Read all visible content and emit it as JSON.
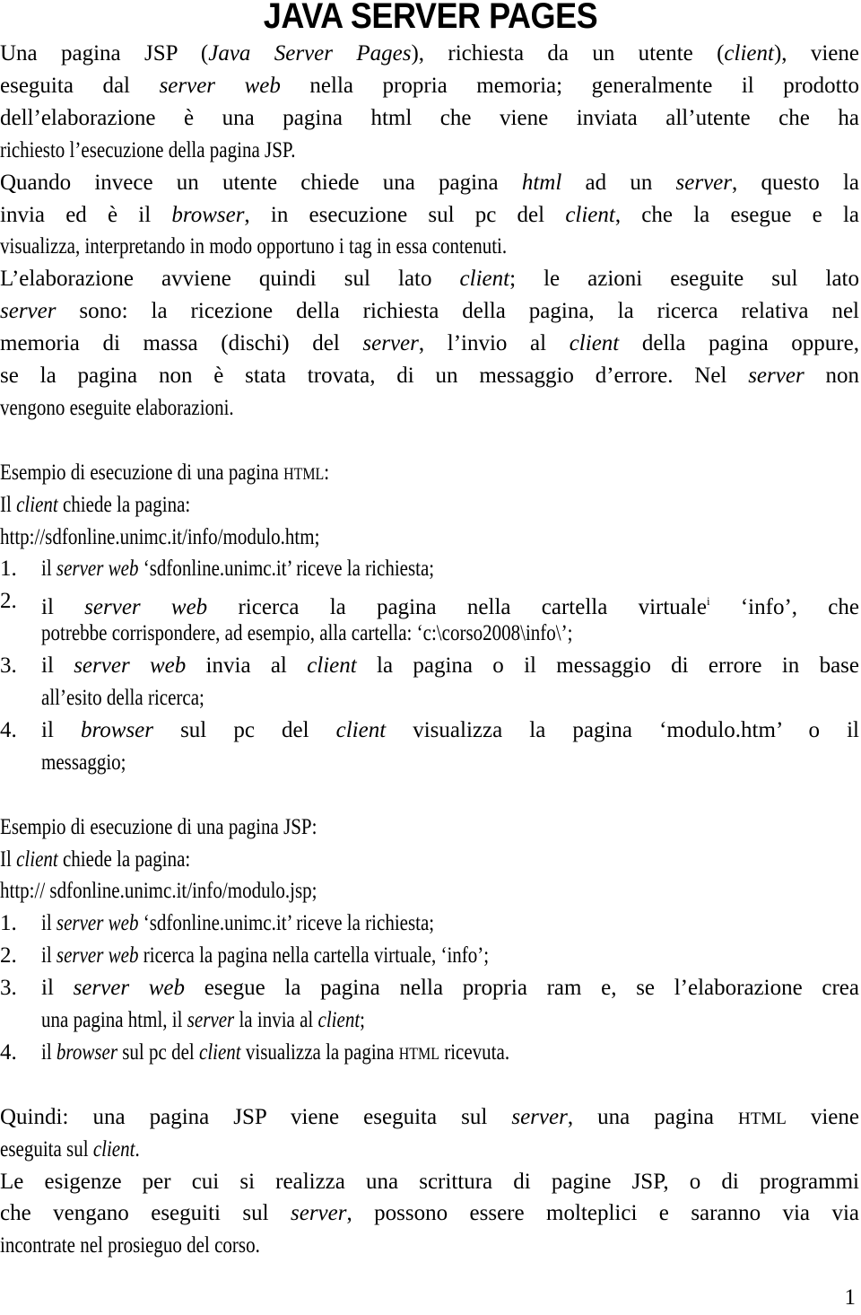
{
  "title": "JAVA SERVER PAGES",
  "page_number": "1",
  "lines": [
    {
      "just": true,
      "segs": [
        [
          "Una pagina JSP (",
          ""
        ],
        [
          "Java Server Pages",
          "i"
        ],
        [
          "), richiesta da un utente (",
          ""
        ],
        [
          "client",
          "i"
        ],
        [
          "),  viene",
          ""
        ]
      ]
    },
    {
      "just": true,
      "segs": [
        [
          "eseguita dal ",
          ""
        ],
        [
          "server web",
          "i"
        ],
        [
          " nella propria memoria; generalmente il prodotto",
          ""
        ]
      ]
    },
    {
      "just": true,
      "segs": [
        [
          "dell’elaborazione è una pagina html che viene inviata all’utente che ha",
          ""
        ]
      ]
    },
    {
      "just": false,
      "segs": [
        [
          "richiesto l’esecuzione della pagina JSP.",
          ""
        ]
      ]
    },
    {
      "just": true,
      "segs": [
        [
          "Quando invece un utente chiede una pagina ",
          ""
        ],
        [
          "html",
          "i"
        ],
        [
          " ad un ",
          ""
        ],
        [
          "server",
          "i"
        ],
        [
          ",  questo la",
          ""
        ]
      ]
    },
    {
      "just": true,
      "segs": [
        [
          "invia  ed è il ",
          ""
        ],
        [
          "browser",
          "i"
        ],
        [
          ", in esecuzione sul pc del ",
          ""
        ],
        [
          "client",
          "i"
        ],
        [
          ", che la esegue e la",
          ""
        ]
      ]
    },
    {
      "just": false,
      "segs": [
        [
          "visualizza, interpretando in modo opportuno i tag in essa contenuti.",
          ""
        ]
      ]
    },
    {
      "just": true,
      "segs": [
        [
          "L’elaborazione avviene quindi sul lato ",
          ""
        ],
        [
          "client",
          "i"
        ],
        [
          "; le azioni eseguite sul lato",
          ""
        ]
      ]
    },
    {
      "just": true,
      "segs": [
        [
          "server",
          "i"
        ],
        [
          " sono: la ricezione della richiesta della pagina,  la ricerca relativa  nel",
          ""
        ]
      ]
    },
    {
      "just": true,
      "segs": [
        [
          "memoria di massa (dischi) del ",
          ""
        ],
        [
          "server",
          "i"
        ],
        [
          ", l’invio al ",
          ""
        ],
        [
          "client",
          "i"
        ],
        [
          " della pagina oppure,",
          ""
        ]
      ]
    },
    {
      "just": true,
      "segs": [
        [
          "se la pagina non è stata trovata, di un messaggio d’errore. Nel ",
          ""
        ],
        [
          "server",
          "i"
        ],
        [
          " non",
          ""
        ]
      ]
    },
    {
      "just": false,
      "segs": [
        [
          "vengono eseguite elaborazioni.",
          ""
        ]
      ]
    },
    {
      "blank": true
    },
    {
      "just": false,
      "segs": [
        [
          "Esempio di esecuzione di una pagina ",
          ""
        ],
        [
          "HTML",
          "sc"
        ],
        [
          ":",
          ""
        ]
      ]
    },
    {
      "just": false,
      "segs": [
        [
          "Il ",
          ""
        ],
        [
          "client",
          "i"
        ],
        [
          " chiede la pagina:",
          ""
        ]
      ]
    },
    {
      "just": false,
      "segs": [
        [
          "http://sdfonline.unimc.it/info/modulo.htm;",
          ""
        ]
      ]
    },
    {
      "just": false,
      "num": "1.",
      "segs": [
        [
          "il ",
          ""
        ],
        [
          "server web",
          "i"
        ],
        [
          " ‘sdfonline.unimc.it’ riceve la richiesta;",
          ""
        ]
      ]
    },
    {
      "just": true,
      "num": "2.",
      "segs": [
        [
          "il ",
          ""
        ],
        [
          "server web",
          "i"
        ],
        [
          " ricerca la pagina nella cartella virtuale",
          ""
        ],
        [
          "i",
          "sup"
        ],
        [
          "  ‘info’, che",
          ""
        ]
      ]
    },
    {
      "just": false,
      "indent": true,
      "segs": [
        [
          "potrebbe corrispondere, ad esempio, alla cartella: ‘c:\\corso2008\\info\\’;",
          ""
        ]
      ]
    },
    {
      "just": true,
      "num": "3.",
      "segs": [
        [
          "il ",
          ""
        ],
        [
          "server web",
          "i"
        ],
        [
          "  invia al ",
          ""
        ],
        [
          "client",
          "i"
        ],
        [
          " la pagina o il messaggio di errore in base",
          ""
        ]
      ]
    },
    {
      "just": false,
      "indent": true,
      "segs": [
        [
          "all’esito della ricerca;",
          ""
        ]
      ]
    },
    {
      "just": true,
      "num": "4.",
      "segs": [
        [
          "il ",
          ""
        ],
        [
          "browser",
          "i"
        ],
        [
          " sul pc del ",
          ""
        ],
        [
          "client",
          "i"
        ],
        [
          " visualizza la pagina ‘modulo.htm’ o il",
          ""
        ]
      ]
    },
    {
      "just": false,
      "indent": true,
      "segs": [
        [
          "messaggio;",
          ""
        ]
      ]
    },
    {
      "blank": true
    },
    {
      "just": false,
      "segs": [
        [
          "Esempio di esecuzione di una pagina JSP:",
          ""
        ]
      ]
    },
    {
      "just": false,
      "segs": [
        [
          "Il ",
          ""
        ],
        [
          "client",
          "i"
        ],
        [
          " chiede la pagina:",
          ""
        ]
      ]
    },
    {
      "just": false,
      "segs": [
        [
          " http:// sdfonline.unimc.it/info/modulo.jsp;",
          ""
        ]
      ]
    },
    {
      "just": false,
      "num": "1.",
      "segs": [
        [
          "il ",
          ""
        ],
        [
          "server web",
          "i"
        ],
        [
          " ‘sdfonline.unimc.it’ riceve la richiesta;",
          ""
        ]
      ]
    },
    {
      "just": false,
      "num": "2.",
      "segs": [
        [
          "il ",
          ""
        ],
        [
          "server web",
          "i"
        ],
        [
          " ricerca la pagina nella cartella virtuale, ‘info’;",
          ""
        ]
      ]
    },
    {
      "just": true,
      "num": "3.",
      "segs": [
        [
          "il ",
          ""
        ],
        [
          "server web",
          "i"
        ],
        [
          " esegue la pagina nella propria ram e, se l’elaborazione crea",
          ""
        ]
      ]
    },
    {
      "just": false,
      "indent": true,
      "segs": [
        [
          "una pagina html, il ",
          ""
        ],
        [
          "server",
          "i"
        ],
        [
          " la invia al ",
          ""
        ],
        [
          "client",
          "i"
        ],
        [
          ";",
          ""
        ]
      ]
    },
    {
      "just": false,
      "num": "4.",
      "segs": [
        [
          "il ",
          ""
        ],
        [
          "browser",
          "i"
        ],
        [
          " sul pc del ",
          ""
        ],
        [
          "client",
          "i"
        ],
        [
          " visualizza la pagina ",
          ""
        ],
        [
          "HTML",
          "sc"
        ],
        [
          " ricevuta.",
          ""
        ]
      ]
    },
    {
      "blank": true
    },
    {
      "just": true,
      "segs": [
        [
          "Quindi: una pagina JSP viene eseguita sul ",
          ""
        ],
        [
          "server",
          "i"
        ],
        [
          ", una pagina ",
          ""
        ],
        [
          "HTML",
          "sc"
        ],
        [
          " viene",
          ""
        ]
      ]
    },
    {
      "just": false,
      "segs": [
        [
          "eseguita sul ",
          ""
        ],
        [
          "client",
          "i"
        ],
        [
          ".",
          ""
        ]
      ]
    },
    {
      "just": true,
      "segs": [
        [
          "Le esigenze per cui si realizza una scrittura di pagine JSP, o di programmi",
          ""
        ]
      ]
    },
    {
      "just": true,
      "segs": [
        [
          "che vengano eseguiti sul ",
          ""
        ],
        [
          "server",
          "i"
        ],
        [
          ", possono essere molteplici e saranno via via",
          ""
        ]
      ]
    },
    {
      "just": false,
      "segs": [
        [
          "incontrate nel prosieguo del corso.",
          ""
        ]
      ]
    }
  ]
}
